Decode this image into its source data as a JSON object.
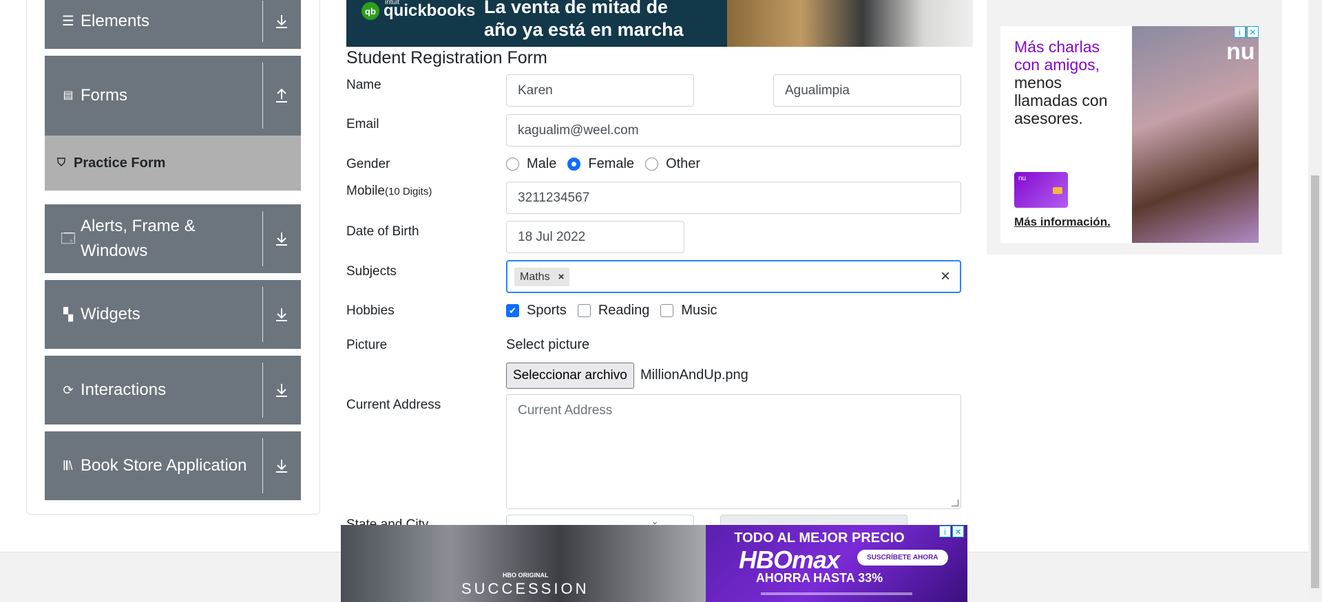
{
  "sidebar": {
    "groups": [
      {
        "label": "Elements",
        "icon": "list-icon",
        "state": "collapsed"
      },
      {
        "label": "Forms",
        "icon": "document-icon",
        "state": "expanded"
      },
      {
        "label": "Alerts, Frame & Windows",
        "icon": "window-icon",
        "state": "collapsed"
      },
      {
        "label": "Widgets",
        "icon": "widgets-icon",
        "state": "collapsed"
      },
      {
        "label": "Interactions",
        "icon": "refresh-icon",
        "state": "collapsed"
      },
      {
        "label": "Book Store Application",
        "icon": "books-icon",
        "state": "collapsed"
      }
    ],
    "active_item": {
      "label": "Practice Form",
      "icon": "html5-icon"
    }
  },
  "ad_top": {
    "brand_small": "intuit",
    "brand": "quickbooks",
    "headline_line1": "La venta de mitad de",
    "headline_line2": "año ya está en marcha"
  },
  "form": {
    "title": "Student Registration Form",
    "labels": {
      "name": "Name",
      "email": "Email",
      "gender": "Gender",
      "mobile": "Mobile",
      "mobile_hint": "(10 Digits)",
      "dob": "Date of Birth",
      "subjects": "Subjects",
      "hobbies": "Hobbies",
      "picture": "Picture",
      "address": "Current Address",
      "state_city": "State and City"
    },
    "first_name": "Karen",
    "last_name": "Agualimpia",
    "email": "kagualim@weel.com",
    "gender_options": [
      "Male",
      "Female",
      "Other"
    ],
    "gender_selected": "Female",
    "mobile": "3211234567",
    "dob": "18 Jul 2022",
    "subjects": [
      "Maths"
    ],
    "hobbies": [
      {
        "label": "Sports",
        "checked": true
      },
      {
        "label": "Reading",
        "checked": false
      },
      {
        "label": "Music",
        "checked": false
      }
    ],
    "picture_label": "Select picture",
    "file_button": "Seleccionar archivo",
    "file_name": "MillionAndUp.png",
    "address_placeholder": "Current Address"
  },
  "ad_right": {
    "headline_purple": "Más charlas con amigos,",
    "headline_dark": "menos llamadas con asesores.",
    "brand": "nu",
    "card_brand": "nu",
    "link": "Más información."
  },
  "ad_bottom": {
    "show_label": "HBO ORIGINAL",
    "show": "SUCCESSION",
    "line1": "TODO AL MEJOR PRECIO",
    "brand": "HBOmax",
    "cta": "SUSCRÍBETE AHORA",
    "line2": "AHORRA HASTA 33%"
  },
  "colors": {
    "sidebar_group": "#6c757d",
    "sidebar_active": "#b0b0b0",
    "accent": "#0d6efd",
    "focus_border": "#2684ff",
    "nubank": "#820ad1",
    "hbo": "#5b1fae"
  }
}
